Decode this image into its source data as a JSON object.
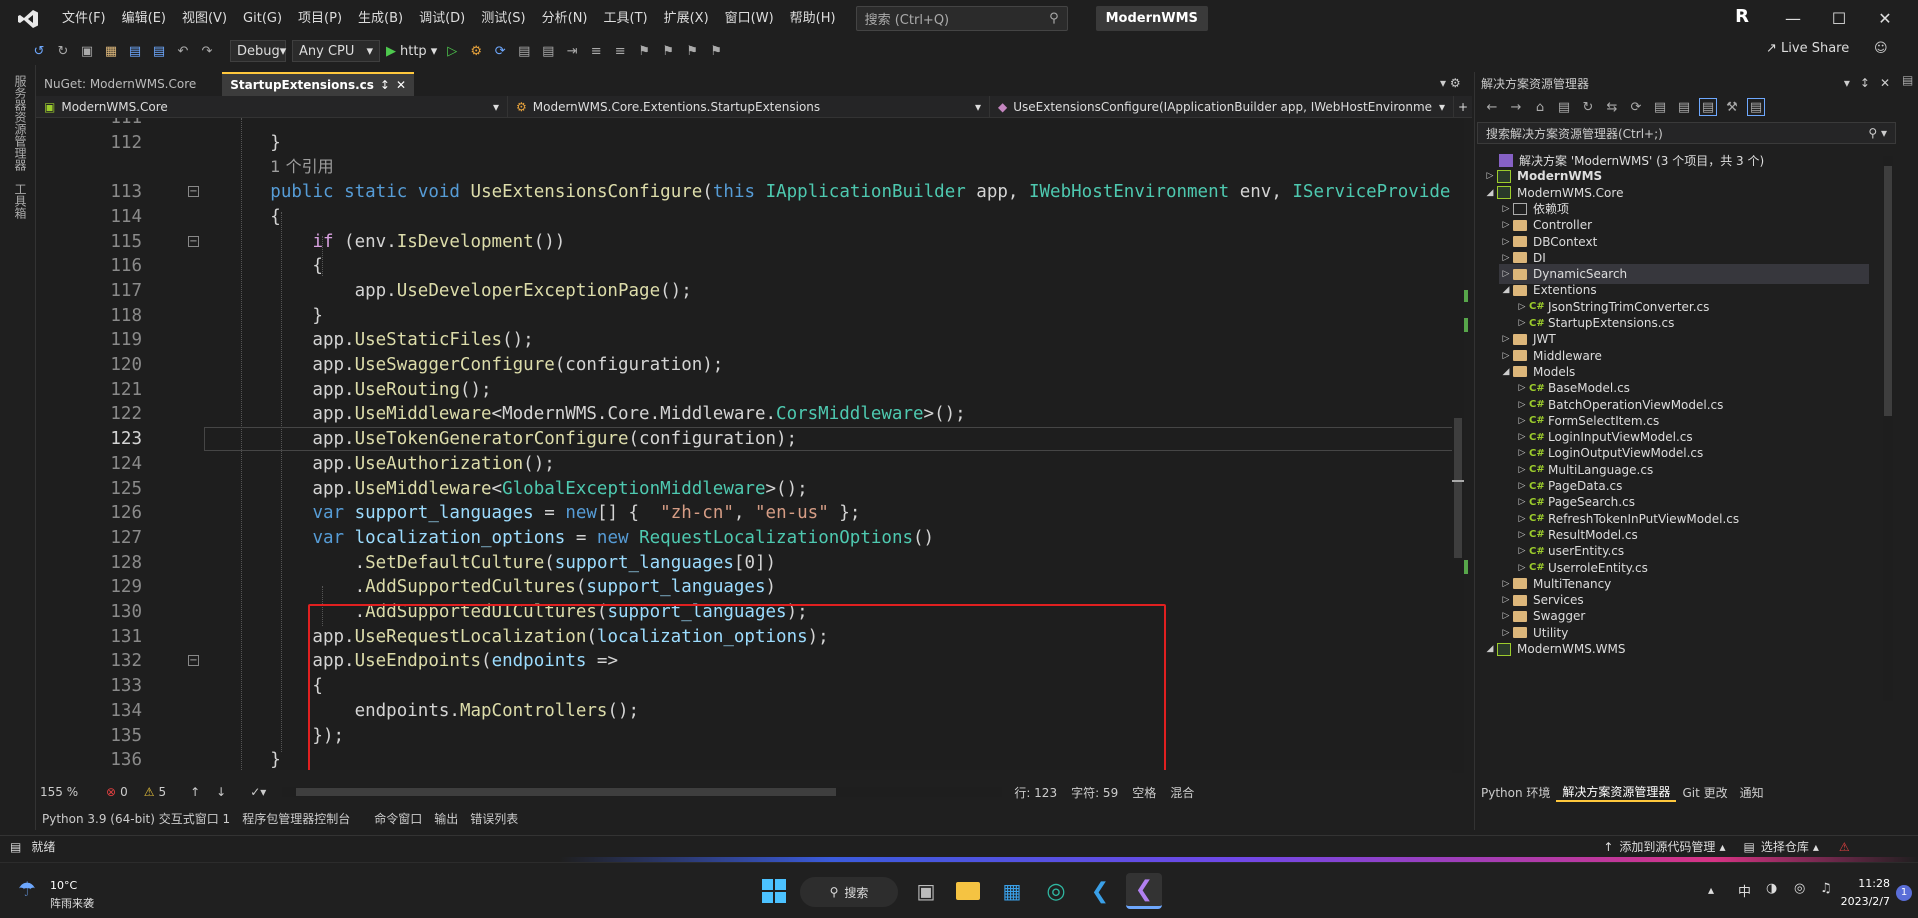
{
  "menubar": {
    "items": [
      "文件(F)",
      "编辑(E)",
      "视图(V)",
      "Git(G)",
      "项目(P)",
      "生成(B)",
      "调试(D)",
      "测试(S)",
      "分析(N)",
      "工具(T)",
      "扩展(X)",
      "窗口(W)",
      "帮助(H)"
    ],
    "search_placeholder": "搜索 (Ctrl+Q)",
    "solution_name": "ModernWMS",
    "avatar": "R"
  },
  "toolbar": {
    "config": "Debug",
    "platform": "Any CPU",
    "run_target": "http",
    "live_share": "Live Share"
  },
  "left_strip": {
    "item1": "服务器资源管理器",
    "item2": "工具箱"
  },
  "tabs": [
    {
      "label": "NuGet: ModernWMS.Core"
    },
    {
      "label": "StartupExtensions.cs"
    }
  ],
  "navbar": {
    "project": "ModernWMS.Core",
    "class": "ModernWMS.Core.Extentions.StartupExtensions",
    "member": "UseExtensionsConfigure(IApplicationBuilder app, IWebHostEnvironment e"
  },
  "code": {
    "lines": [
      {
        "n": "111",
        "tokens": []
      },
      {
        "n": "112",
        "tokens": [
          {
            "t": "        }",
            "c": ""
          }
        ]
      },
      {
        "n": "",
        "tokens": [
          {
            "t": "        ",
            "c": ""
          },
          {
            "t": "1 个引用",
            "c": "ref"
          }
        ]
      },
      {
        "n": "113",
        "tokens": [
          {
            "t": "        ",
            "c": ""
          },
          {
            "t": "public",
            "c": "kw"
          },
          {
            "t": " ",
            "c": ""
          },
          {
            "t": "static",
            "c": "kw"
          },
          {
            "t": " ",
            "c": ""
          },
          {
            "t": "void",
            "c": "kw"
          },
          {
            "t": " ",
            "c": ""
          },
          {
            "t": "UseExtensionsConfigure",
            "c": "fn"
          },
          {
            "t": "(",
            "c": ""
          },
          {
            "t": "this",
            "c": "kw"
          },
          {
            "t": " ",
            "c": ""
          },
          {
            "t": "IApplicationBuilder",
            "c": "ty"
          },
          {
            "t": " app, ",
            "c": ""
          },
          {
            "t": "IWebHostEnvironment",
            "c": "ty"
          },
          {
            "t": " env, ",
            "c": ""
          },
          {
            "t": "IServiceProvider",
            "c": "ty"
          },
          {
            "t": " s",
            "c": ""
          }
        ]
      },
      {
        "n": "114",
        "tokens": [
          {
            "t": "        {",
            "c": ""
          }
        ]
      },
      {
        "n": "115",
        "tokens": [
          {
            "t": "            ",
            "c": ""
          },
          {
            "t": "if",
            "c": "kw2"
          },
          {
            "t": " (env.",
            "c": ""
          },
          {
            "t": "IsDevelopment",
            "c": "fn"
          },
          {
            "t": "())",
            "c": ""
          }
        ]
      },
      {
        "n": "116",
        "tokens": [
          {
            "t": "            {",
            "c": ""
          }
        ]
      },
      {
        "n": "117",
        "tokens": [
          {
            "t": "                app.",
            "c": ""
          },
          {
            "t": "UseDeveloperExceptionPage",
            "c": "fn"
          },
          {
            "t": "();",
            "c": ""
          }
        ]
      },
      {
        "n": "118",
        "tokens": [
          {
            "t": "            }",
            "c": ""
          }
        ]
      },
      {
        "n": "119",
        "tokens": [
          {
            "t": "            app.",
            "c": ""
          },
          {
            "t": "UseStaticFiles",
            "c": "fn"
          },
          {
            "t": "();",
            "c": ""
          }
        ]
      },
      {
        "n": "120",
        "tokens": [
          {
            "t": "            app.",
            "c": ""
          },
          {
            "t": "UseSwaggerConfigure",
            "c": "fn"
          },
          {
            "t": "(configuration);",
            "c": ""
          }
        ]
      },
      {
        "n": "121",
        "tokens": [
          {
            "t": "            app.",
            "c": ""
          },
          {
            "t": "UseRouting",
            "c": "fn"
          },
          {
            "t": "();",
            "c": ""
          }
        ]
      },
      {
        "n": "122",
        "tokens": [
          {
            "t": "            app.",
            "c": ""
          },
          {
            "t": "UseMiddleware",
            "c": "fn"
          },
          {
            "t": "<ModernWMS.Core.Middleware.",
            "c": ""
          },
          {
            "t": "CorsMiddleware",
            "c": "ty"
          },
          {
            "t": ">();",
            "c": ""
          }
        ]
      },
      {
        "n": "123",
        "tokens": [
          {
            "t": "            app.",
            "c": ""
          },
          {
            "t": "UseTokenGeneratorConfigure",
            "c": "fn"
          },
          {
            "t": "(configuration);",
            "c": ""
          }
        ]
      },
      {
        "n": "124",
        "tokens": [
          {
            "t": "            app.",
            "c": ""
          },
          {
            "t": "UseAuthorization",
            "c": "fn"
          },
          {
            "t": "();",
            "c": ""
          }
        ]
      },
      {
        "n": "125",
        "tokens": [
          {
            "t": "            app.",
            "c": ""
          },
          {
            "t": "UseMiddleware",
            "c": "fn"
          },
          {
            "t": "<",
            "c": ""
          },
          {
            "t": "GlobalExceptionMiddleware",
            "c": "ty"
          },
          {
            "t": ">();",
            "c": ""
          }
        ]
      },
      {
        "n": "126",
        "tokens": [
          {
            "t": "            ",
            "c": ""
          },
          {
            "t": "var",
            "c": "kw"
          },
          {
            "t": " ",
            "c": ""
          },
          {
            "t": "support_languages",
            "c": "var"
          },
          {
            "t": " = ",
            "c": ""
          },
          {
            "t": "new",
            "c": "kw"
          },
          {
            "t": "[] {  ",
            "c": ""
          },
          {
            "t": "\"zh-cn\"",
            "c": "str"
          },
          {
            "t": ", ",
            "c": ""
          },
          {
            "t": "\"en-us\"",
            "c": "str"
          },
          {
            "t": " };",
            "c": ""
          }
        ]
      },
      {
        "n": "127",
        "tokens": [
          {
            "t": "            ",
            "c": ""
          },
          {
            "t": "var",
            "c": "kw"
          },
          {
            "t": " ",
            "c": ""
          },
          {
            "t": "localization_options",
            "c": "var"
          },
          {
            "t": " = ",
            "c": ""
          },
          {
            "t": "new",
            "c": "kw"
          },
          {
            "t": " ",
            "c": ""
          },
          {
            "t": "RequestLocalizationOptions",
            "c": "ty"
          },
          {
            "t": "()",
            "c": ""
          }
        ]
      },
      {
        "n": "128",
        "tokens": [
          {
            "t": "                .",
            "c": ""
          },
          {
            "t": "SetDefaultCulture",
            "c": "fn"
          },
          {
            "t": "(",
            "c": ""
          },
          {
            "t": "support_languages",
            "c": "var"
          },
          {
            "t": "[0])",
            "c": ""
          }
        ]
      },
      {
        "n": "129",
        "tokens": [
          {
            "t": "                .",
            "c": ""
          },
          {
            "t": "AddSupportedCultures",
            "c": "fn"
          },
          {
            "t": "(",
            "c": ""
          },
          {
            "t": "support_languages",
            "c": "var"
          },
          {
            "t": ")",
            "c": ""
          }
        ]
      },
      {
        "n": "130",
        "tokens": [
          {
            "t": "                .",
            "c": ""
          },
          {
            "t": "AddSupportedUICultures",
            "c": "fn"
          },
          {
            "t": "(",
            "c": ""
          },
          {
            "t": "support_languages",
            "c": "var"
          },
          {
            "t": ");",
            "c": ""
          }
        ]
      },
      {
        "n": "131",
        "tokens": [
          {
            "t": "            app.",
            "c": ""
          },
          {
            "t": "UseRequestLocalization",
            "c": "fn"
          },
          {
            "t": "(",
            "c": ""
          },
          {
            "t": "localization_options",
            "c": "var"
          },
          {
            "t": ");",
            "c": ""
          }
        ]
      },
      {
        "n": "132",
        "tokens": [
          {
            "t": "            app.",
            "c": ""
          },
          {
            "t": "UseEndpoints",
            "c": "fn"
          },
          {
            "t": "(",
            "c": ""
          },
          {
            "t": "endpoints",
            "c": "var"
          },
          {
            "t": " =>",
            "c": ""
          }
        ]
      },
      {
        "n": "133",
        "tokens": [
          {
            "t": "            {",
            "c": ""
          }
        ]
      },
      {
        "n": "134",
        "tokens": [
          {
            "t": "                endpoints.",
            "c": ""
          },
          {
            "t": "MapControllers",
            "c": "fn"
          },
          {
            "t": "();",
            "c": ""
          }
        ]
      },
      {
        "n": "135",
        "tokens": [
          {
            "t": "            });",
            "c": ""
          }
        ]
      },
      {
        "n": "136",
        "tokens": [
          {
            "t": "        }",
            "c": ""
          }
        ]
      }
    ],
    "current_line": "123"
  },
  "editor_status": {
    "zoom": "155 %",
    "errors": "0",
    "warnings": "5",
    "position": "行: 123",
    "char": "字符: 59",
    "whitespace": "空格",
    "line_ending": "混合"
  },
  "bottom_tabs": [
    "Python 3.9 (64-bit) 交互式窗口 1",
    "程序包管理器控制台",
    "命令窗口",
    "输出",
    "错误列表"
  ],
  "solution_explorer": {
    "title": "解决方案资源管理器",
    "search_placeholder": "搜索解决方案资源管理器(Ctrl+;)",
    "tree": [
      {
        "label": "解决方案 'ModernWMS' (3 个项目，共 3 个)",
        "icon": "sln",
        "level": 0,
        "arrow": ""
      },
      {
        "label": "ModernWMS",
        "icon": "proj",
        "level": 0,
        "arrow": "▷",
        "bold": true
      },
      {
        "label": "ModernWMS.Core",
        "icon": "proj",
        "level": 0,
        "arrow": "◢"
      },
      {
        "label": "依赖项",
        "icon": "deps",
        "level": 1,
        "arrow": "▷"
      },
      {
        "label": "Controller",
        "icon": "folder",
        "level": 1,
        "arrow": "▷"
      },
      {
        "label": "DBContext",
        "icon": "folder",
        "level": 1,
        "arrow": "▷"
      },
      {
        "label": "DI",
        "icon": "folder",
        "level": 1,
        "arrow": "▷"
      },
      {
        "label": "DynamicSearch",
        "icon": "folder",
        "level": 1,
        "arrow": "▷",
        "selected": true
      },
      {
        "label": "Extentions",
        "icon": "folder",
        "level": 1,
        "arrow": "◢"
      },
      {
        "label": "JsonStringTrimConverter.cs",
        "icon": "cs",
        "level": 2,
        "arrow": "▷"
      },
      {
        "label": "StartupExtensions.cs",
        "icon": "cs",
        "level": 2,
        "arrow": "▷"
      },
      {
        "label": "JWT",
        "icon": "folder",
        "level": 1,
        "arrow": "▷"
      },
      {
        "label": "Middleware",
        "icon": "folder",
        "level": 1,
        "arrow": "▷"
      },
      {
        "label": "Models",
        "icon": "folder",
        "level": 1,
        "arrow": "◢"
      },
      {
        "label": "BaseModel.cs",
        "icon": "cs",
        "level": 2,
        "arrow": "▷"
      },
      {
        "label": "BatchOperationViewModel.cs",
        "icon": "cs",
        "level": 2,
        "arrow": "▷"
      },
      {
        "label": "FormSelectItem.cs",
        "icon": "cs",
        "level": 2,
        "arrow": "▷"
      },
      {
        "label": "LoginInputViewModel.cs",
        "icon": "cs",
        "level": 2,
        "arrow": "▷"
      },
      {
        "label": "LoginOutputViewModel.cs",
        "icon": "cs",
        "level": 2,
        "arrow": "▷"
      },
      {
        "label": "MultiLanguage.cs",
        "icon": "cs",
        "level": 2,
        "arrow": "▷"
      },
      {
        "label": "PageData.cs",
        "icon": "cs",
        "level": 2,
        "arrow": "▷"
      },
      {
        "label": "PageSearch.cs",
        "icon": "cs",
        "level": 2,
        "arrow": "▷"
      },
      {
        "label": "RefreshTokenInPutViewModel.cs",
        "icon": "cs",
        "level": 2,
        "arrow": "▷"
      },
      {
        "label": "ResultModel.cs",
        "icon": "cs",
        "level": 2,
        "arrow": "▷"
      },
      {
        "label": "userEntity.cs",
        "icon": "cs",
        "level": 2,
        "arrow": "▷"
      },
      {
        "label": "UserroleEntity.cs",
        "icon": "cs",
        "level": 2,
        "arrow": "▷"
      },
      {
        "label": "MultiTenancy",
        "icon": "folder",
        "level": 1,
        "arrow": "▷"
      },
      {
        "label": "Services",
        "icon": "folder",
        "level": 1,
        "arrow": "▷"
      },
      {
        "label": "Swagger",
        "icon": "folder",
        "level": 1,
        "arrow": "▷"
      },
      {
        "label": "Utility",
        "icon": "folder",
        "level": 1,
        "arrow": "▷"
      },
      {
        "label": "ModernWMS.WMS",
        "icon": "proj",
        "level": 0,
        "arrow": "◢"
      }
    ],
    "bottom_tabs": [
      "Python 环境",
      "解决方案资源管理器",
      "Git 更改",
      "通知"
    ]
  },
  "statusbar": {
    "ready": "就绪",
    "add_source": "添加到源代码管理",
    "select_repo": "选择仓库"
  },
  "taskbar": {
    "weather_temp": "10°C",
    "weather_desc": "阵雨来袭",
    "search": "搜索",
    "tray_lang": "中",
    "time": "11:28",
    "date": "2023/2/7",
    "notif": "1"
  }
}
